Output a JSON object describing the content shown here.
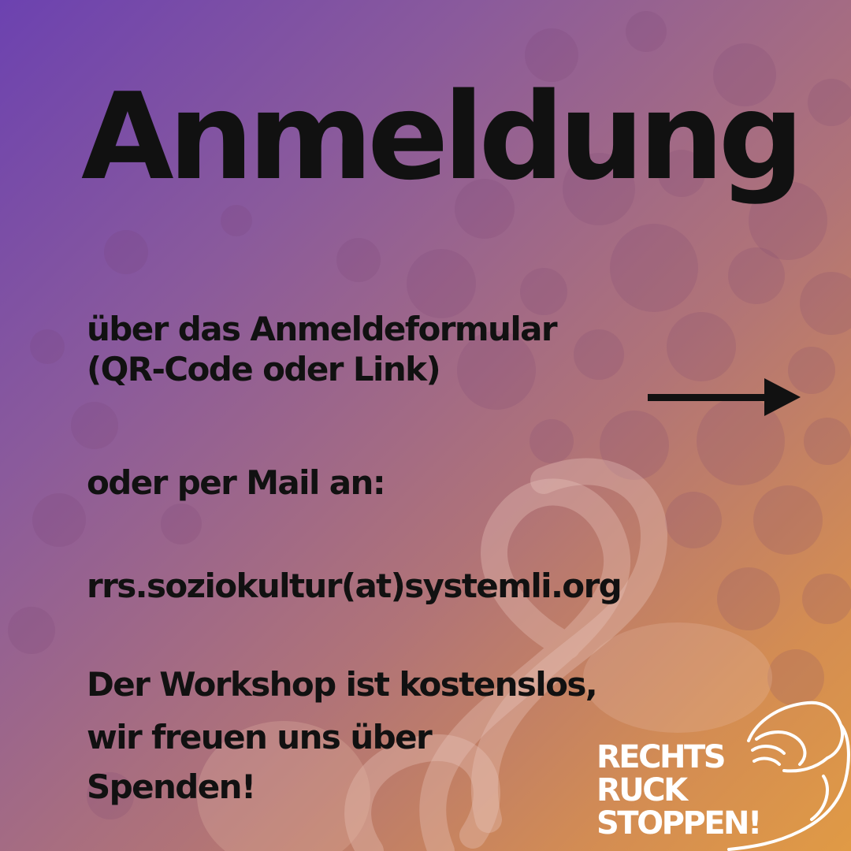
{
  "title": "Anmeldung",
  "lines": {
    "form": "über das Anmeldeformular",
    "form_hint": "(QR-Code oder Link)",
    "mail_intro": "oder per Mail an:",
    "email": "rrs.soziokultur(at)systemli.org",
    "note_1": "Der Workshop ist kostenslos,",
    "note_2": "wir freuen uns über",
    "note_3": "Spenden!"
  },
  "logo": {
    "line_1": "RECHTS",
    "line_2": "RUCK",
    "line_3": "STOPPEN!",
    "icon": "handshake-icon"
  },
  "icons": {
    "arrow": "arrow-right-icon"
  },
  "colors": {
    "gradient_start": "#6c42b0",
    "gradient_end": "#e09a45",
    "text": "#111111",
    "logo_text": "#ffffff"
  }
}
